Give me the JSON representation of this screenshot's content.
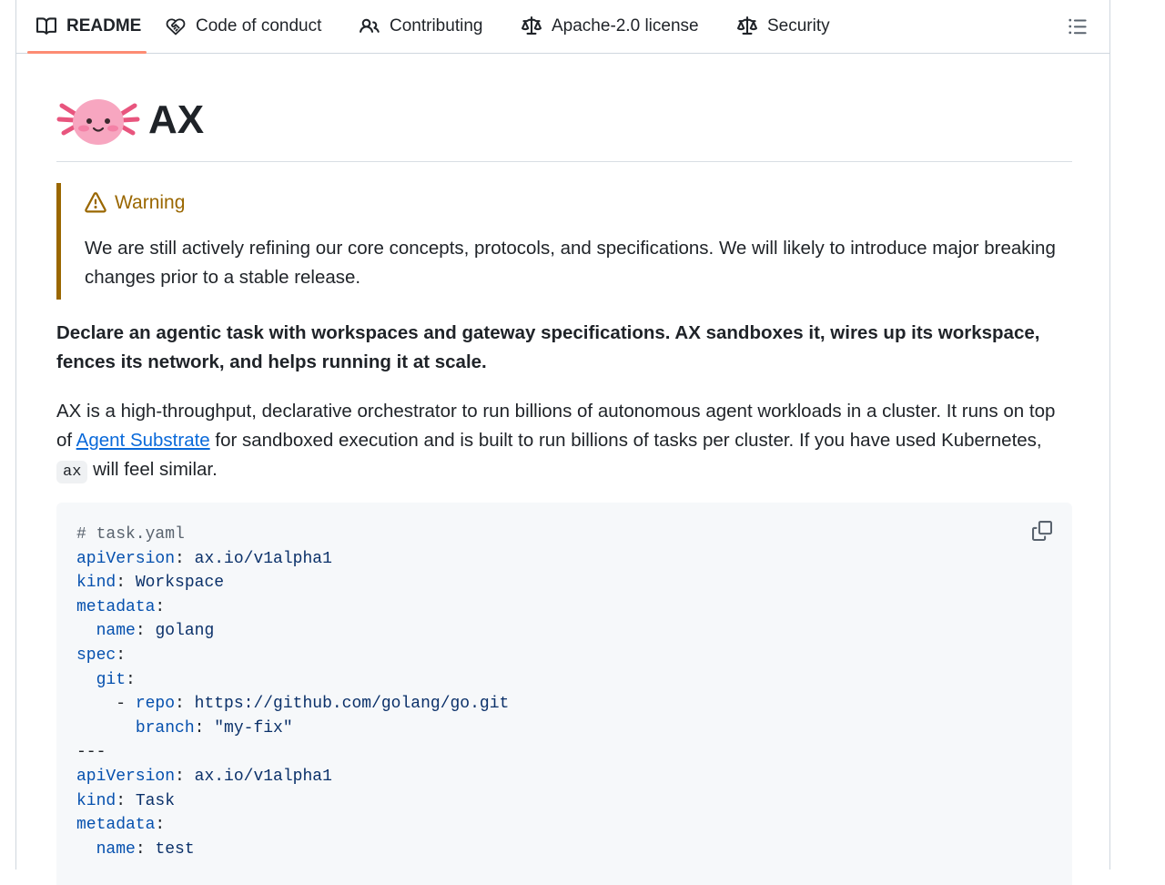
{
  "tabs": [
    {
      "label": "README",
      "icon": "book-icon",
      "active": true
    },
    {
      "label": "Code of conduct",
      "icon": "heart-handshake-icon",
      "active": false
    },
    {
      "label": "Contributing",
      "icon": "people-icon",
      "active": false
    },
    {
      "label": "Apache-2.0 license",
      "icon": "law-scale-icon",
      "active": false
    },
    {
      "label": "Security",
      "icon": "law-scale-icon",
      "active": false
    }
  ],
  "readme": {
    "title": "AX",
    "warning": {
      "title": "Warning",
      "body": "We are still actively refining our core concepts, protocols, and specifications. We will likely to introduce major breaking changes prior to a stable release."
    },
    "lead": "Declare an agentic task with workspaces and gateway specifications. AX sandboxes it, wires up its workspace, fences its network, and helps running it at scale.",
    "para": {
      "before_link": "AX is a high-throughput, declarative orchestrator to run billions of autonomous agent workloads in a cluster. It runs on top of ",
      "link_text": "Agent Substrate",
      "after_link": " for sandboxed execution and is built to run billions of tasks per cluster. If you have used Kubernetes, ",
      "inline_code": "ax",
      "end": " will feel similar."
    },
    "code_lines": [
      {
        "comment": "# task.yaml"
      },
      {
        "key": "apiVersion",
        "value": "ax.io/v1alpha1"
      },
      {
        "key": "kind",
        "value": "Workspace"
      },
      {
        "key": "metadata",
        "value": ""
      },
      {
        "indent": "  ",
        "key": "name",
        "value": "golang"
      },
      {
        "key": "spec",
        "value": ""
      },
      {
        "indent": "  ",
        "key": "git",
        "value": ""
      },
      {
        "indent": "    - ",
        "key": "repo",
        "value": "https://github.com/golang/go.git"
      },
      {
        "indent": "      ",
        "key": "branch",
        "value": "\"my-fix\""
      },
      {
        "plain": "---"
      },
      {
        "key": "apiVersion",
        "value": "ax.io/v1alpha1"
      },
      {
        "key": "kind",
        "value": "Task"
      },
      {
        "key": "metadata",
        "value": ""
      },
      {
        "indent": "  ",
        "key": "name",
        "value": "test"
      }
    ]
  },
  "colors": {
    "active_tab_underline": "#fd8c73",
    "warning": "#9a6700",
    "link": "#0969da",
    "code_bg": "#f6f8fa",
    "yaml_key": "#0550ae"
  }
}
